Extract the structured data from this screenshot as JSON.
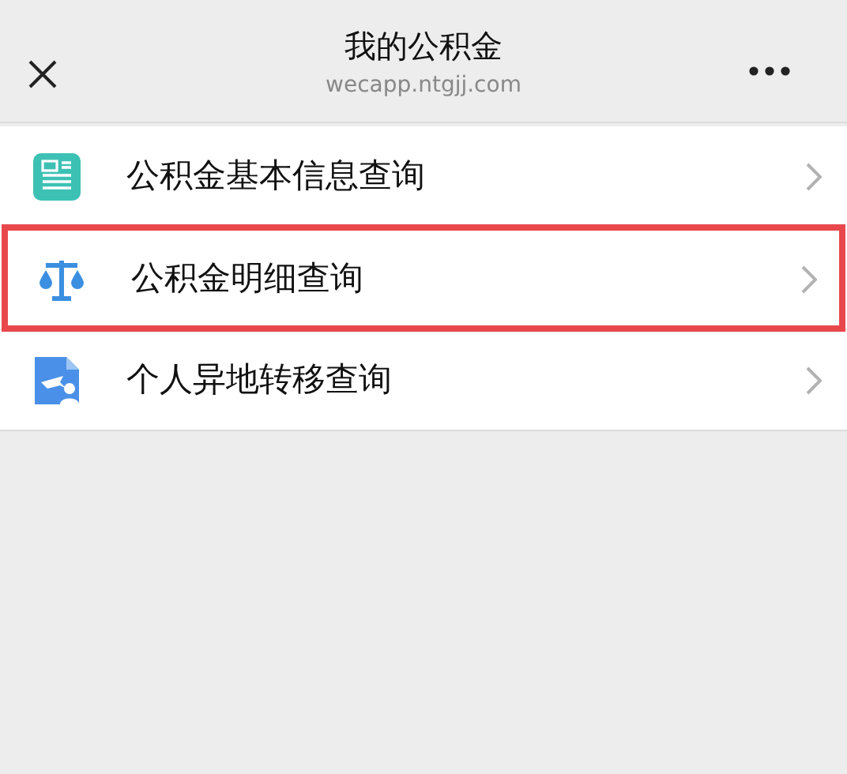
{
  "header": {
    "title": "我的公积金",
    "subtitle": "wecapp.ntgjj.com"
  },
  "items": [
    {
      "kind": "document",
      "label": "公积金基本信息查询",
      "highlighted": false
    },
    {
      "kind": "scale",
      "label": "公积金明细查询",
      "highlighted": true
    },
    {
      "kind": "transfer",
      "label": "个人异地转移查询",
      "highlighted": false
    }
  ]
}
